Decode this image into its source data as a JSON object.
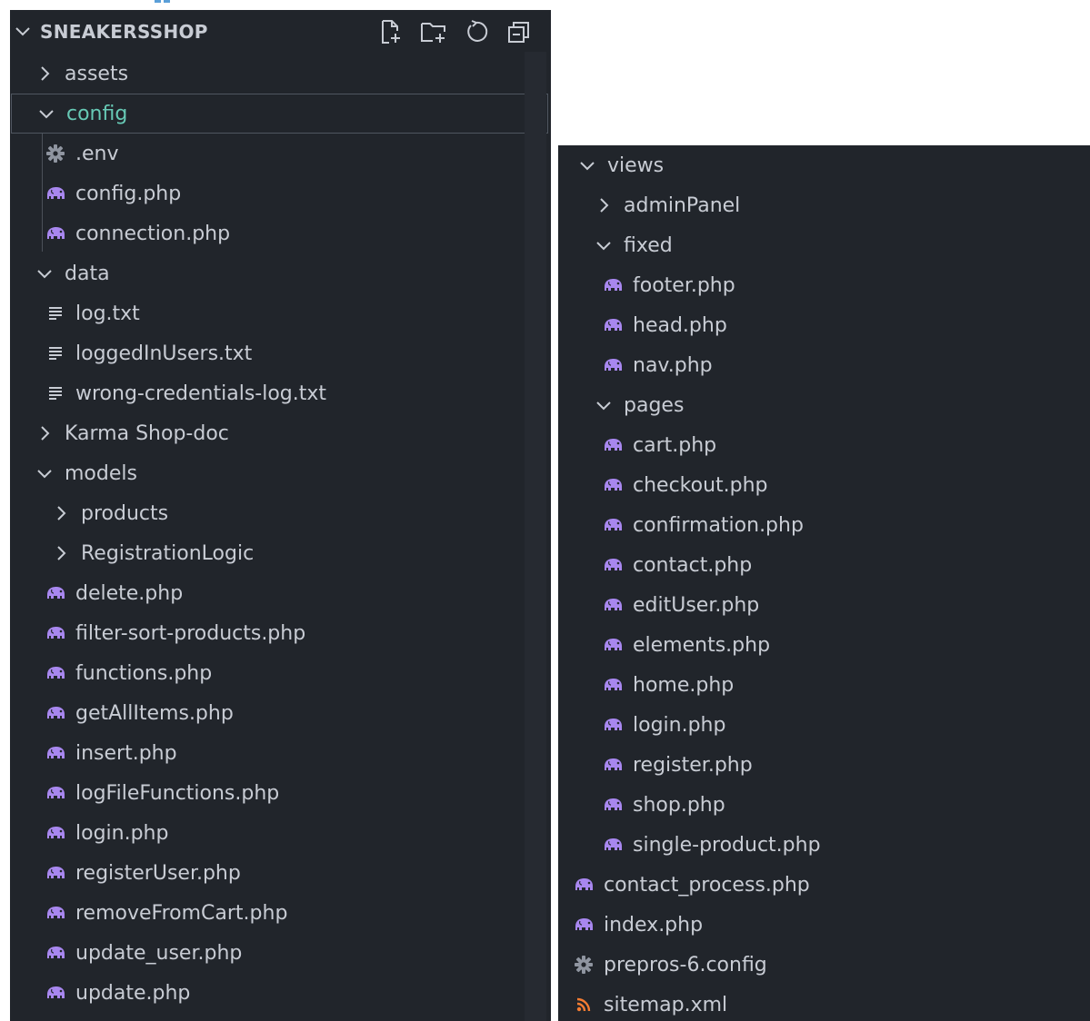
{
  "colors": {
    "panel_bg": "#21252b",
    "text": "#c8ccd4",
    "selected_text": "#67c9b5",
    "php_icon": "#a887ef",
    "gear_icon": "#8f95a0",
    "rss_icon": "#f47c32",
    "text_icon": "#c8ccd4"
  },
  "explorer": {
    "title": "SNEAKERSSHOP",
    "actions": [
      "new-file-icon",
      "new-folder-icon",
      "refresh-icon",
      "collapse-all-icon"
    ]
  },
  "left_tree": [
    {
      "name": "assets",
      "type": "folder",
      "expanded": false,
      "depth": 0
    },
    {
      "name": "config",
      "type": "folder",
      "expanded": true,
      "depth": 0,
      "selected": true
    },
    {
      "name": ".env",
      "type": "env",
      "depth": 1
    },
    {
      "name": "config.php",
      "type": "php",
      "depth": 1
    },
    {
      "name": "connection.php",
      "type": "php",
      "depth": 1
    },
    {
      "name": "data",
      "type": "folder",
      "expanded": true,
      "depth": 0
    },
    {
      "name": "log.txt",
      "type": "txt",
      "depth": 1
    },
    {
      "name": "loggedInUsers.txt",
      "type": "txt",
      "depth": 1
    },
    {
      "name": "wrong-credentials-log.txt",
      "type": "txt",
      "depth": 1
    },
    {
      "name": "Karma Shop-doc",
      "type": "folder",
      "expanded": false,
      "depth": 0
    },
    {
      "name": "models",
      "type": "folder",
      "expanded": true,
      "depth": 0
    },
    {
      "name": "products",
      "type": "folder",
      "expanded": false,
      "depth": 1
    },
    {
      "name": "RegistrationLogic",
      "type": "folder",
      "expanded": false,
      "depth": 1
    },
    {
      "name": "delete.php",
      "type": "php",
      "depth": 1
    },
    {
      "name": "filter-sort-products.php",
      "type": "php",
      "depth": 1
    },
    {
      "name": "functions.php",
      "type": "php",
      "depth": 1
    },
    {
      "name": "getAllItems.php",
      "type": "php",
      "depth": 1
    },
    {
      "name": "insert.php",
      "type": "php",
      "depth": 1
    },
    {
      "name": "logFileFunctions.php",
      "type": "php",
      "depth": 1
    },
    {
      "name": "login.php",
      "type": "php",
      "depth": 1
    },
    {
      "name": "registerUser.php",
      "type": "php",
      "depth": 1
    },
    {
      "name": "removeFromCart.php",
      "type": "php",
      "depth": 1
    },
    {
      "name": "update_user.php",
      "type": "php",
      "depth": 1
    },
    {
      "name": "update.php",
      "type": "php",
      "depth": 1
    }
  ],
  "right_tree": [
    {
      "name": "views",
      "type": "folder",
      "expanded": true,
      "depth": 0
    },
    {
      "name": "adminPanel",
      "type": "folder",
      "expanded": false,
      "depth": 1
    },
    {
      "name": "fixed",
      "type": "folder",
      "expanded": true,
      "depth": 1
    },
    {
      "name": "footer.php",
      "type": "php",
      "depth": 2
    },
    {
      "name": "head.php",
      "type": "php",
      "depth": 2
    },
    {
      "name": "nav.php",
      "type": "php",
      "depth": 2
    },
    {
      "name": "pages",
      "type": "folder",
      "expanded": true,
      "depth": 1
    },
    {
      "name": "cart.php",
      "type": "php",
      "depth": 2
    },
    {
      "name": "checkout.php",
      "type": "php",
      "depth": 2
    },
    {
      "name": "confirmation.php",
      "type": "php",
      "depth": 2
    },
    {
      "name": "contact.php",
      "type": "php",
      "depth": 2
    },
    {
      "name": "editUser.php",
      "type": "php",
      "depth": 2
    },
    {
      "name": "elements.php",
      "type": "php",
      "depth": 2
    },
    {
      "name": "home.php",
      "type": "php",
      "depth": 2
    },
    {
      "name": "login.php",
      "type": "php",
      "depth": 2
    },
    {
      "name": "register.php",
      "type": "php",
      "depth": 2
    },
    {
      "name": "shop.php",
      "type": "php",
      "depth": 2
    },
    {
      "name": "single-product.php",
      "type": "php",
      "depth": 2
    },
    {
      "name": "contact_process.php",
      "type": "php",
      "depth": 0
    },
    {
      "name": "index.php",
      "type": "php",
      "depth": 0
    },
    {
      "name": "prepros-6.config",
      "type": "config",
      "depth": 0
    },
    {
      "name": "sitemap.xml",
      "type": "xml",
      "depth": 0
    }
  ]
}
